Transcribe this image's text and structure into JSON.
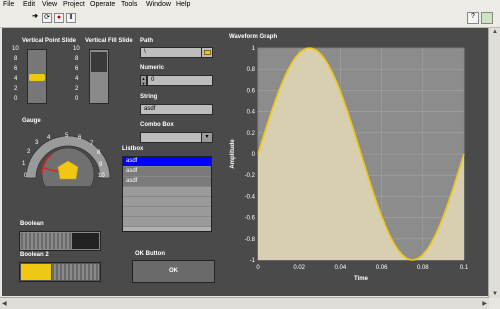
{
  "menu": [
    "File",
    "Edit",
    "View",
    "Project",
    "Operate",
    "Tools",
    "Window",
    "Help"
  ],
  "vertical_point_slide": {
    "label": "Vertical Point Slide",
    "ticks": [
      "10",
      "8",
      "6",
      "4",
      "2",
      "0"
    ],
    "value": 0.5
  },
  "vertical_fill_slide": {
    "label": "Vertical Fill Slide",
    "ticks": [
      "10",
      "8",
      "6",
      "4",
      "2",
      "0"
    ],
    "value": 0
  },
  "gauge": {
    "label": "Gauge",
    "ticks": [
      "0",
      "1",
      "2",
      "3",
      "4",
      "5",
      "6",
      "7",
      "8",
      "9",
      "10"
    ],
    "needle_value": 2.5
  },
  "path": {
    "label": "Path",
    "value": "\\"
  },
  "numeric": {
    "label": "Numeric",
    "value": "0"
  },
  "string": {
    "label": "String",
    "value": "asdf"
  },
  "combo": {
    "label": "Combo Box",
    "value": ""
  },
  "listbox": {
    "label": "Listbox",
    "items": [
      "asdf",
      "asdf",
      "asdf"
    ],
    "selected_index": 0
  },
  "boolean": {
    "label": "Boolean",
    "on": false
  },
  "boolean2": {
    "label": "Boolean 2",
    "on": true
  },
  "ok_button": {
    "label": "OK Button",
    "text": "OK"
  },
  "colors": {
    "accent": "#f0c814",
    "panel": "#4a4a4a",
    "selection": "#0000ff"
  },
  "chart_data": {
    "type": "area",
    "title": "Waveform Graph",
    "xlabel": "Time",
    "ylabel": "Amplitude",
    "xlim": [
      0,
      0.1
    ],
    "ylim": [
      -1,
      1
    ],
    "x_ticks": [
      "0",
      "0.02",
      "0.04",
      "0.06",
      "0.08",
      "0.1"
    ],
    "y_ticks": [
      "1",
      "0.8",
      "0.6",
      "0.4",
      "0.2",
      "0",
      "-0.2",
      "-0.4",
      "-0.6",
      "-0.8",
      "-1"
    ],
    "series": [
      {
        "function": "sine",
        "frequency_hz": 10,
        "amplitude": 1,
        "samples": 51
      }
    ],
    "grid": true
  }
}
